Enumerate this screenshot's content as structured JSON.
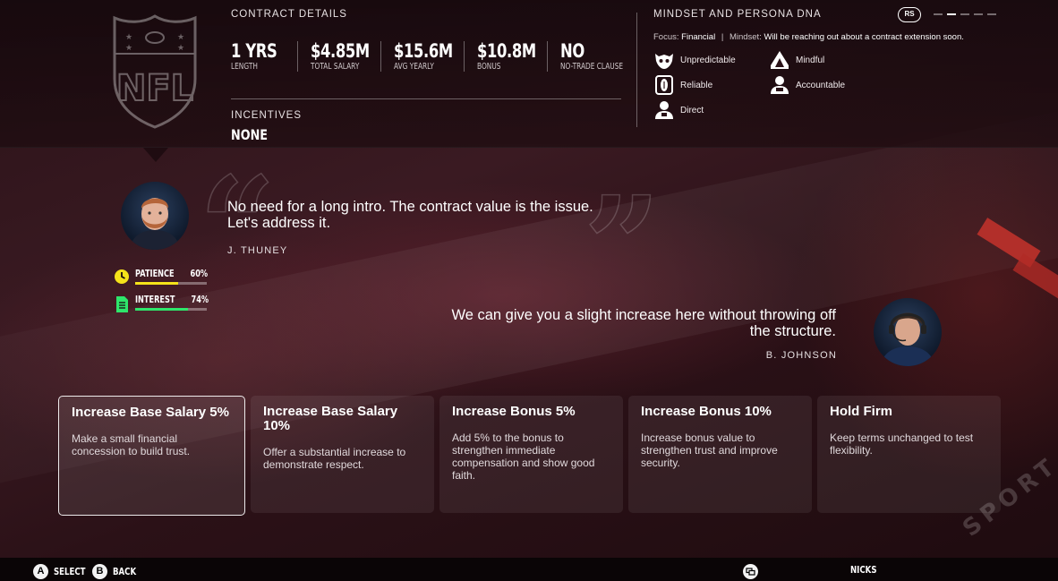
{
  "contract": {
    "title": "CONTRACT DETAILS",
    "stats": [
      {
        "value": "1 YRS",
        "label": "LENGTH"
      },
      {
        "value": "$4.85M",
        "label": "TOTAL SALARY"
      },
      {
        "value": "$15.6M",
        "label": "AVG YEARLY"
      },
      {
        "value": "$10.8M",
        "label": "BONUS"
      },
      {
        "value": "NO",
        "label": "NO-TRADE CLAUSE"
      }
    ],
    "incentives_title": "INCENTIVES",
    "incentives_value": "NONE"
  },
  "mindset": {
    "title": "MINDSET AND PERSONA DNA",
    "rs_label": "RS",
    "focus_label": "Focus:",
    "focus_value": "Financial",
    "separator": "|",
    "mindset_label": "Mindset:",
    "mindset_value": "Will be reaching out about a contract extension soon.",
    "traits": [
      {
        "label": "Unpredictable",
        "icon": "mask-icon"
      },
      {
        "label": "Mindful",
        "icon": "tent-icon"
      },
      {
        "label": "Reliable",
        "icon": "football-icon"
      },
      {
        "label": "Accountable",
        "icon": "person-icon"
      },
      {
        "label": "Direct",
        "icon": "person-icon"
      }
    ],
    "page_dashes": 5,
    "active_dash": 2
  },
  "player": {
    "quote": "No need for a long intro. The contract value is the issue. Let's address it.",
    "name": "J. THUNEY",
    "patience": {
      "label": "PATIENCE",
      "value": "60%",
      "fraction": 0.6,
      "color": "#f5e31a"
    },
    "interest": {
      "label": "INTEREST",
      "value": "74%",
      "fraction": 0.74,
      "color": "#2ee66b"
    }
  },
  "coach": {
    "quote": "We can give you a slight increase here without throwing off the structure.",
    "name": "B. JOHNSON"
  },
  "options": [
    {
      "title": "Increase Base Salary 5%",
      "desc": "Make a small financial concession to build trust."
    },
    {
      "title": "Increase Base Salary 10%",
      "desc": "Offer a substantial increase to demonstrate respect."
    },
    {
      "title": "Increase Bonus 5%",
      "desc": "Add 5% to the bonus to strengthen immediate compensation and show good faith."
    },
    {
      "title": "Increase Bonus 10%",
      "desc": "Increase bonus value to strengthen trust and improve security."
    },
    {
      "title": "Hold Firm",
      "desc": "Keep terms unchanged to test flexibility."
    }
  ],
  "footer": {
    "select_key": "A",
    "select_label": "SELECT",
    "back_key": "B",
    "back_label": "BACK",
    "team_label": "NICKS"
  }
}
